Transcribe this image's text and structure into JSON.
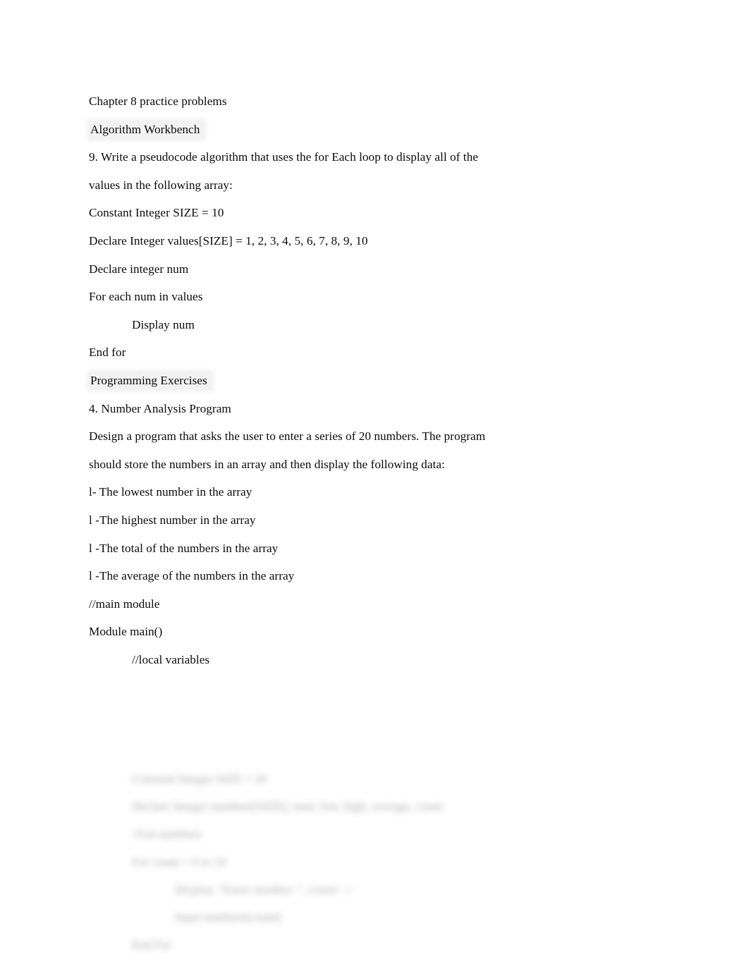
{
  "document": {
    "title": "Chapter 8 practice problems",
    "page_background": "#ffffff",
    "text_color": "#0b0b0b",
    "highlight_color": "#f2f2f2",
    "sections": {
      "heading_1": "Algorithm Workbench",
      "heading_2": "Programming Exercises"
    },
    "body_lines": {
      "l01": "Chapter 8 practice problems",
      "l02": "Algorithm Workbench",
      "l03": "9. Write a pseudocode algorithm that uses the for Each loop to display all of the",
      "l04": "values in the following array:",
      "l05": "Constant Integer SIZE = 10",
      "l06": "Declare Integer values[SIZE] = 1, 2, 3, 4, 5, 6, 7, 8, 9, 10",
      "l07": "Declare integer num",
      "l08": "For each num in values",
      "l09": "Display num",
      "l10": "End for",
      "l11": "Programming Exercises",
      "l12": "4. Number Analysis Program",
      "l13": "Design a program that asks the user to enter a series of 20 numbers. The program",
      "l14": "should store the numbers in an array and then display the following data:",
      "l15": "l- The lowest number in the array",
      "l16": "l -The highest number in the array",
      "l17": "l -The total of the numbers in the array",
      "l18": "l -The average of the numbers in the array",
      "l19": "//main module",
      "l20": "Module main()",
      "l21": "//local variables"
    },
    "faded_lines": {
      "f01": "Constant Integer SIZE = 20",
      "f02": "Declare Integer numbers[SIZE], total, low, high, average, count",
      "f03": "//Get numbers",
      "f04": "For count = 0 to 19",
      "f05": "Display \"Enter number \", count",
      "f06": "Input numbers[count]",
      "f07": "End For",
      "f05_tail": "+ 1",
      "note": "lower portion of page is blurred / illegible"
    }
  }
}
